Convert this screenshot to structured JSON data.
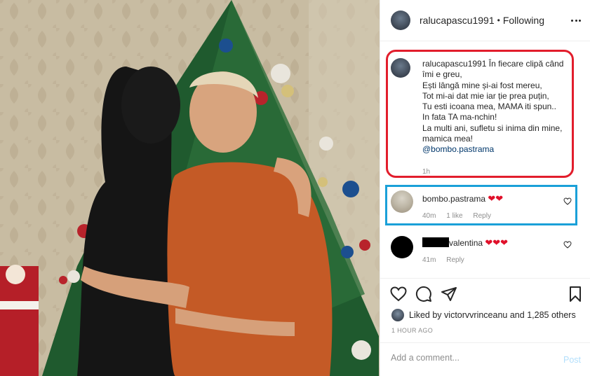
{
  "post": {
    "username": "ralucapascu1991",
    "separator": "•",
    "follow_status": "Following"
  },
  "caption": {
    "username": "ralucapascu1991",
    "lines": [
      "În fiecare clipă când îmi e greu,",
      "Ești lângă mine și-ai fost mereu,",
      "Tot mi-ai dat mie iar ție prea puțin,",
      "Tu esti icoana mea, MAMA iti spun..",
      "In fata TA ma-nchin!",
      "La multi ani, sufletu si inima din mine, mamica mea!"
    ],
    "mention": "@bombo.pastrama",
    "time": "1h"
  },
  "comments": [
    {
      "username": "bombo.pastrama",
      "text": "❤❤",
      "time": "40m",
      "likes": "1 like",
      "reply": "Reply"
    },
    {
      "username": "valentina",
      "text": "❤❤❤",
      "time": "41m",
      "reply": "Reply"
    }
  ],
  "likes": {
    "prefix": "Liked by",
    "user": "victorvvrinceanu",
    "connector": "and",
    "others": "1,285 others"
  },
  "posted_time": "1 HOUR AGO",
  "add_comment": {
    "placeholder": "Add a comment...",
    "post_label": "Post"
  },
  "colors": {
    "highlight_red": "#e21d2c",
    "highlight_blue": "#1aa0d8",
    "heart": "#e0102a",
    "link": "#00376b",
    "post_disabled": "#b2dffc"
  }
}
